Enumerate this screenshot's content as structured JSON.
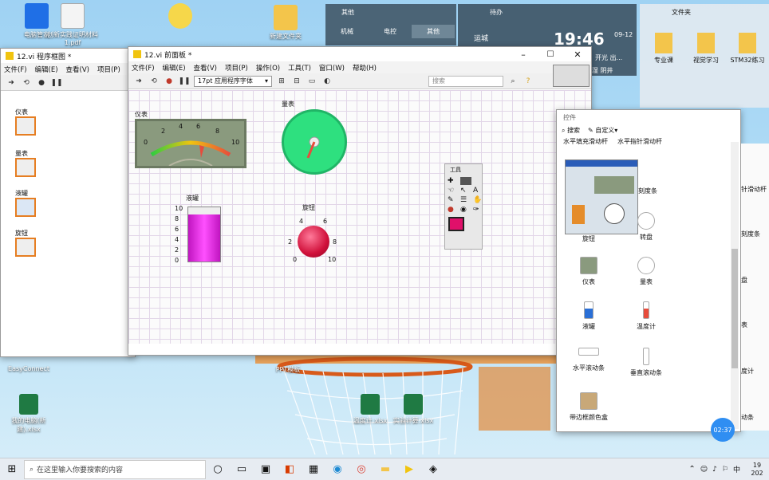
{
  "desktop": {
    "icons": [
      {
        "label": "电脑管家"
      },
      {
        "label": "创新实践证明材料1.pdf"
      },
      {
        "label": "新建文件夹"
      },
      {
        "label": "专业课"
      },
      {
        "label": "视觉学习"
      },
      {
        "label": "STM32练习"
      },
      {
        "label": "EasyConnect"
      },
      {
        "label": "PPT模板"
      },
      {
        "label": "我的电脑(新建).xlsx"
      },
      {
        "label": "温度计.xlsx"
      },
      {
        "label": "实验计算.xlsx"
      }
    ]
  },
  "widgets": {
    "other_panel": {
      "title": "其他",
      "tabs": [
        "机械",
        "电控",
        "其他"
      ]
    },
    "weather": {
      "title": "待办",
      "location": "运城",
      "time": "19:46",
      "date": "09-12",
      "desc": "开光 出...",
      "extra": "重湿 阴井"
    },
    "files_panel": {
      "title": "文件夹"
    }
  },
  "block_diagram": {
    "title": "12.vi 程序框图 *",
    "menu": [
      "文件(F)",
      "编辑(E)",
      "查看(V)",
      "项目(P)"
    ],
    "items": [
      "仪表",
      "量表",
      "液罐",
      "旋钮"
    ]
  },
  "front_panel": {
    "title": "12.vi 前面板 *",
    "menu": [
      "文件(F)",
      "编辑(E)",
      "查看(V)",
      "项目(P)",
      "操作(O)",
      "工具(T)",
      "窗口(W)",
      "帮助(H)"
    ],
    "font_select": "17pt 应用程序字体",
    "search_placeholder": "搜索",
    "meter": {
      "label": "仪表",
      "ticks": [
        "0",
        "2",
        "4",
        "6",
        "8",
        "10"
      ]
    },
    "gauge": {
      "label": "量表",
      "ticks": [
        "0",
        "1",
        "2",
        "3",
        "4",
        "5",
        "6",
        "7",
        "8",
        "9",
        "10"
      ]
    },
    "tank": {
      "label": "液罐",
      "ticks": [
        "10",
        "8",
        "6",
        "4",
        "2",
        "0"
      ],
      "level": 0.87
    },
    "knob": {
      "label": "旋钮",
      "ticks": [
        "0",
        "2",
        "4",
        "6",
        "8",
        "10"
      ]
    }
  },
  "tools_palette": {
    "title": "工具"
  },
  "controls_palette": {
    "title": "控件",
    "search_label": "搜索",
    "custom_label": "自定义▾",
    "top_labels": [
      "水平填充滑动杆",
      "水平指针滑动杆"
    ],
    "items": [
      "旋钮",
      "转盘",
      "仪表",
      "量表",
      "液罐",
      "温度计",
      "水平滚动条",
      "垂直滚动条",
      "带边框颜色盒"
    ],
    "tooltip_label": "刻度条",
    "right_fragments": [
      "针滑动杆",
      "刻度条",
      "盘",
      "表",
      "度计",
      "动条"
    ]
  },
  "taskbar": {
    "search_placeholder": "在这里输入你要搜索的内容",
    "time": "19",
    "year": "202",
    "ime": "中",
    "clock_bubble": "02:37"
  }
}
